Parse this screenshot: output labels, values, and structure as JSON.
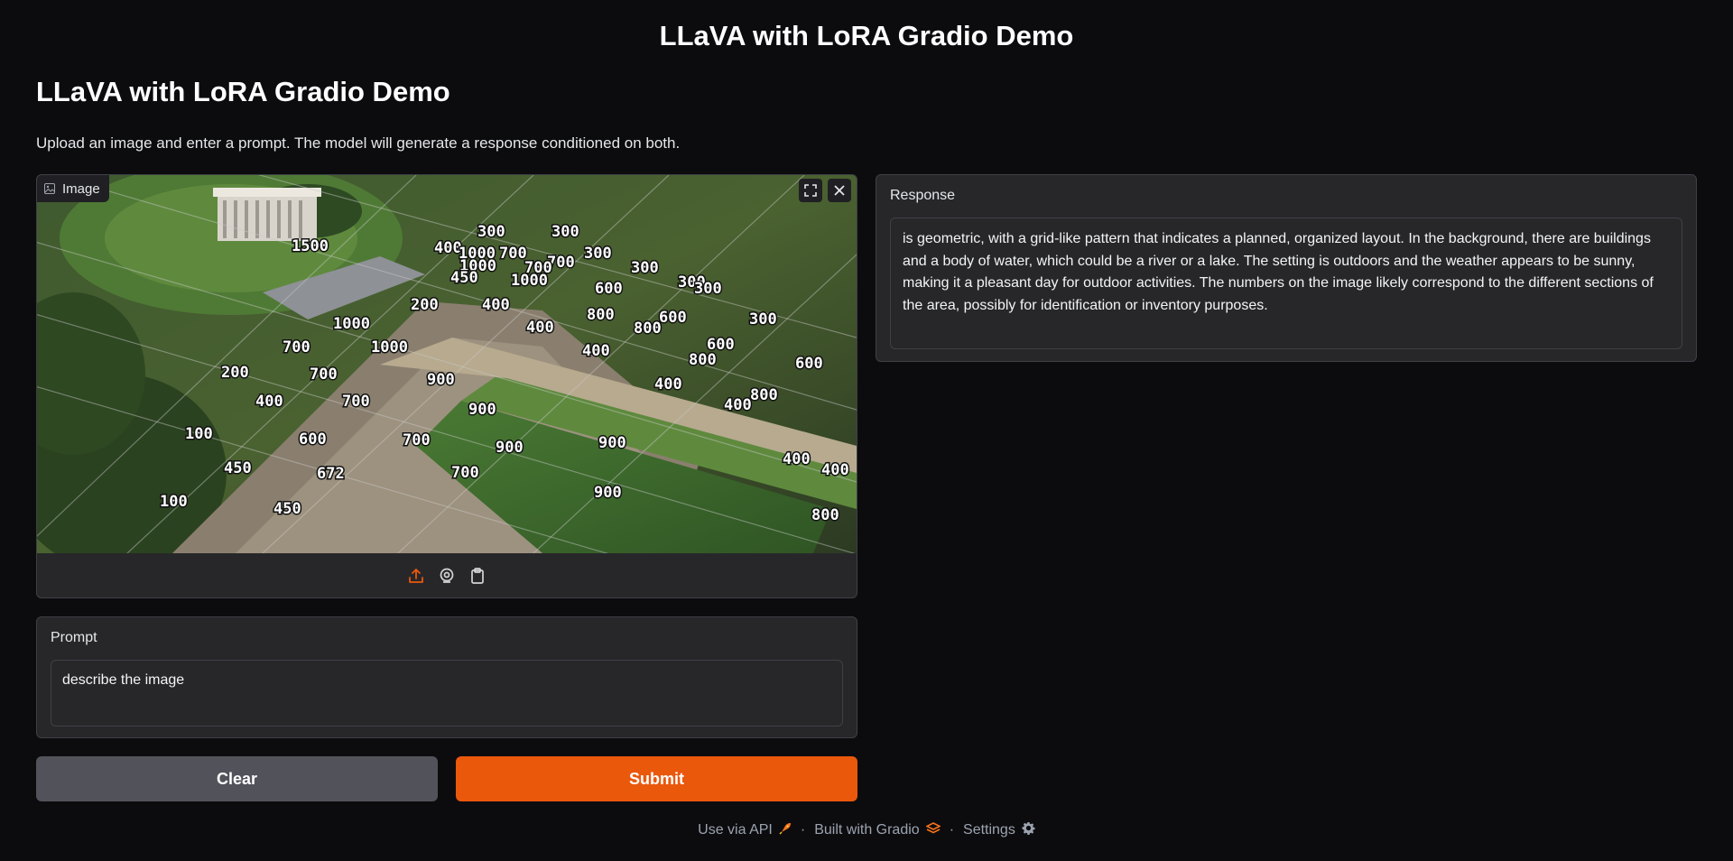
{
  "app_title": "LLaVA with LoRA Gradio Demo",
  "page_title": "LLaVA with LoRA Gradio Demo",
  "description": "Upload an image and enter a prompt. The model will generate a response conditioned on both.",
  "image_panel": {
    "label": "Image",
    "image_numbers": [
      "1500",
      "300",
      "300",
      "400",
      "1000",
      "700",
      "300",
      "700",
      "300",
      "1000",
      "700",
      "300",
      "450",
      "1000",
      "600",
      "300",
      "200",
      "400",
      "800",
      "600",
      "1000",
      "400",
      "800",
      "300",
      "700",
      "1000",
      "600",
      "400",
      "800",
      "600",
      "200",
      "700",
      "900",
      "400",
      "800",
      "400",
      "700",
      "900",
      "400",
      "100",
      "600",
      "700",
      "900",
      "900",
      "400",
      "450",
      "672",
      "700",
      "900",
      "400",
      "100",
      "450",
      "800"
    ]
  },
  "prompt": {
    "label": "Prompt",
    "value": "describe the image"
  },
  "response": {
    "label": "Response",
    "text": "is geometric, with a grid-like pattern that indicates a planned, organized layout. In the background, there are buildings and a body of water, which could be a river or a lake. The setting is outdoors and the weather appears to be sunny, making it a pleasant day for outdoor activities. The numbers on the image likely correspond to the different sections of the area, possibly for identification or inventory purposes."
  },
  "buttons": {
    "clear": "Clear",
    "submit": "Submit"
  },
  "footer": {
    "api": "Use via API",
    "built": "Built with Gradio",
    "settings": "Settings",
    "separator": "·"
  },
  "colors": {
    "accent": "#ea580c",
    "background": "#0c0c0f",
    "panel": "#27272a"
  }
}
